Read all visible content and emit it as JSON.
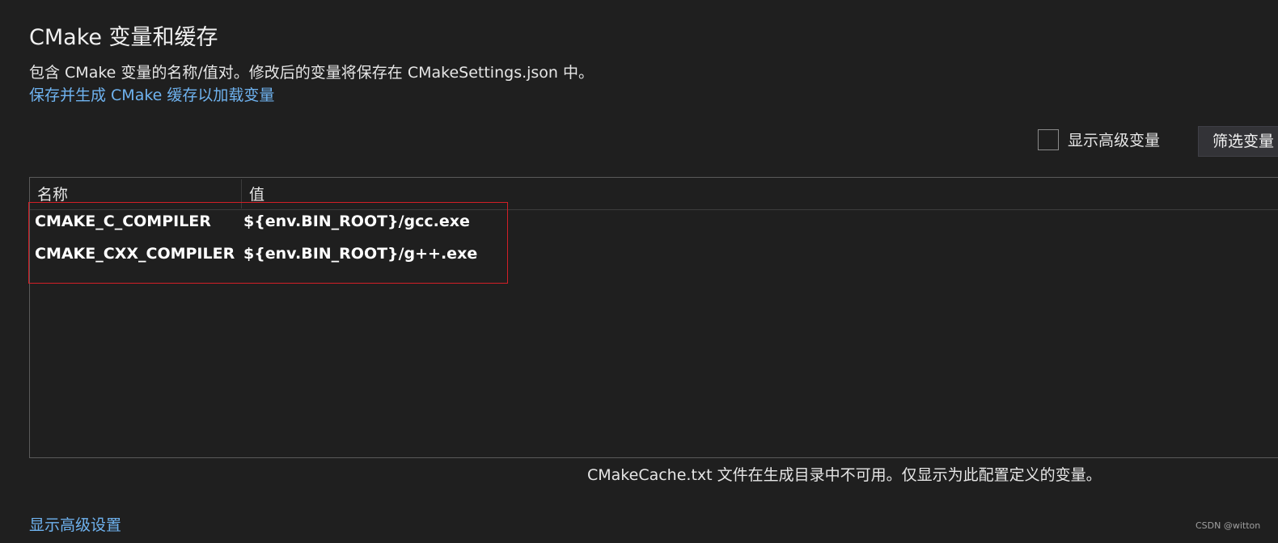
{
  "page": {
    "title": "CMake 变量和缓存",
    "description": "包含 CMake 变量的名称/值对。修改后的变量将保存在 CMakeSettings.json 中。",
    "save_link": "保存并生成 CMake 缓存以加载变量"
  },
  "toolbar": {
    "show_advanced_label": "显示高级变量",
    "show_advanced_checked": false,
    "filter_button": "筛选变量"
  },
  "grid": {
    "columns": [
      "名称",
      "值"
    ],
    "rows": [
      {
        "name": "CMAKE_C_COMPILER",
        "value": "${env.BIN_ROOT}/gcc.exe"
      },
      {
        "name": "CMAKE_CXX_COMPILER",
        "value": "${env.BIN_ROOT}/g++.exe"
      }
    ]
  },
  "status": {
    "message": "CMakeCache.txt 文件在生成目录中不可用。仅显示为此配置定义的变量。"
  },
  "footer": {
    "advanced_settings_link": "显示高级设置",
    "watermark": "CSDN @witton"
  },
  "colors": {
    "background": "#1f1f1f",
    "link": "#6fb3f0",
    "highlight_border": "#d21f26"
  }
}
